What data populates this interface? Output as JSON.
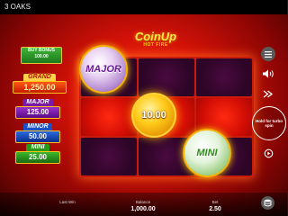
{
  "header": {
    "title": "3 OAKS"
  },
  "logo": {
    "main": "CoinUp",
    "sub": "HOT FIRE"
  },
  "buy_bonus": {
    "label": "BUY BONUS",
    "value": "100.00"
  },
  "jackpots": {
    "grand": {
      "label": "GRAND",
      "value": "1,250.00"
    },
    "major": {
      "label": "MAJOR",
      "value": "125.00"
    },
    "minor": {
      "label": "MINOR",
      "value": "50.00"
    },
    "mini": {
      "label": "MINI",
      "value": "25.00"
    }
  },
  "coins": {
    "major": "MAJOR",
    "center": "10.00",
    "mini": "MINI"
  },
  "controls": {
    "spin_hint": "Hold for turbo spin"
  },
  "footer": {
    "last_win_label": "Last Win",
    "last_win_value": "",
    "balance_label": "Balance",
    "balance_value": "1,000.00",
    "bet_label": "Bet",
    "bet_value": "2.50"
  },
  "colors": {
    "background": "#d41208",
    "reel_cell": "#2d0526",
    "active_cell": "#ff2a10",
    "gold": "#ffc21a"
  }
}
